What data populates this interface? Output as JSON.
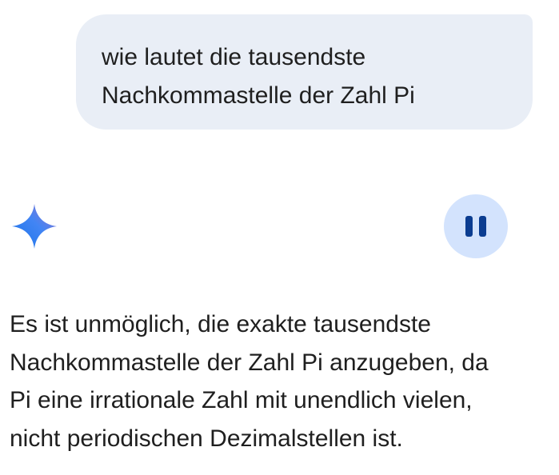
{
  "user_message": {
    "lines": [
      "wie lautet die tausendste",
      "Nachkommastelle der Zahl Pi"
    ]
  },
  "assistant": {
    "icon": "gemini-sparkle-icon",
    "icon_colors": [
      "#4285f4",
      "#1a73e8",
      "#9b72cb"
    ],
    "control": {
      "icon": "pause-icon",
      "background": "#d3e3fd",
      "foreground": "#0b3d91"
    },
    "response_lines": [
      "Es ist unmöglich, die exakte tausendste",
      "Nachkommastelle der Zahl Pi anzugeben, da",
      "Pi eine irrationale Zahl mit unendlich vielen,",
      "nicht periodischen Dezimalstellen ist."
    ]
  },
  "colors": {
    "user_bubble": "#e9eef6",
    "text": "#1f1f1f"
  }
}
